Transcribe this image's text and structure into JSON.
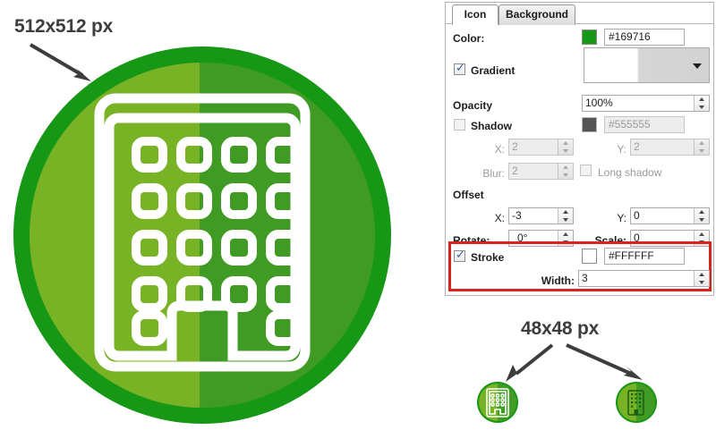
{
  "annotations": {
    "large_size_label": "512x512 px",
    "small_size_label": "48x48 px"
  },
  "icon_preview": {
    "ring_color": "#169716",
    "fill_light": "#78b225",
    "fill_dark": "#1e8c24",
    "stroke_color": "#FFFFFF",
    "shape": "building-icon"
  },
  "panel": {
    "tabs": [
      {
        "label": "Icon",
        "active": true
      },
      {
        "label": "Background",
        "active": false
      }
    ],
    "color": {
      "label": "Color:",
      "swatch_color": "#169716",
      "value": "#169716"
    },
    "gradient": {
      "label": "Gradient",
      "checked": true,
      "preview_from": "#FFFFFF",
      "preview_to": "#D2D2D2"
    },
    "opacity": {
      "label": "Opacity",
      "value": "100%"
    },
    "shadow": {
      "label": "Shadow",
      "checked": false,
      "swatch_color": "#555555",
      "color_value": "#555555",
      "x_label": "X:",
      "x_value": "2",
      "y_label": "Y:",
      "y_value": "2",
      "blur_label": "Blur:",
      "blur_value": "2",
      "long_shadow_label": "Long shadow",
      "long_shadow_checked": false
    },
    "offset": {
      "label": "Offset",
      "x_label": "X:",
      "x_value": "-3",
      "y_label": "Y:",
      "y_value": "0"
    },
    "transform": {
      "rotate_label": "Rotate:",
      "rotate_value": "0°",
      "scale_label": "Scale:",
      "scale_value": "0"
    },
    "stroke": {
      "label": "Stroke",
      "checked": true,
      "swatch_color": "#FFFFFF",
      "color_value": "#FFFFFF",
      "width_label": "Width:",
      "width_value": "3",
      "highlight_color": "#D8241D"
    }
  }
}
